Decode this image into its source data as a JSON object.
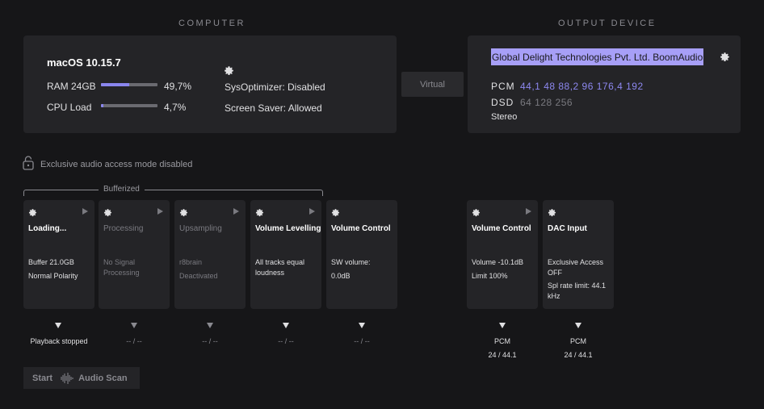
{
  "sections": {
    "computer": "COMPUTER",
    "output": "OUTPUT DEVICE"
  },
  "computer": {
    "os": "macOS 10.15.7",
    "ram_label": "RAM 24GB",
    "ram_value": "49,7%",
    "ram_fraction": 0.497,
    "cpu_label": "CPU Load",
    "cpu_value": "4,7%",
    "cpu_fraction": 0.047,
    "sysoptimizer": "SysOptimizer: Disabled",
    "screensaver": "Screen Saver: Allowed"
  },
  "virtual_button": "Virtual",
  "output": {
    "device": "Global Delight Technologies Pvt. Ltd. BoomAudio",
    "pcm_label": "PCM",
    "pcm_rates": "44,1 48 88,2 96 176,4 192",
    "dsd_label": "DSD",
    "dsd_rates": "64 128 256",
    "channels": "Stereo"
  },
  "exclusive": "Exclusive audio access mode disabled",
  "bufferized": "Bufferized",
  "stages": [
    {
      "title": "Loading...",
      "desc1": "Buffer 21.0GB",
      "desc2": "Normal Polarity",
      "under": "Playback stopped"
    },
    {
      "title": "Processing",
      "desc1": "No Signal Processing",
      "desc2": "",
      "under": "-- / --"
    },
    {
      "title": "Upsampling",
      "desc1": "r8brain",
      "desc2": "Deactivated",
      "under": "-- / --"
    },
    {
      "title": "Volume Levelling",
      "desc1": "All tracks equal loudness",
      "desc2": "",
      "under": "-- / --"
    },
    {
      "title": "Volume Control",
      "desc1": "SW volume:",
      "desc2": "0.0dB",
      "under": "-- / --"
    },
    {
      "title": "Volume Control",
      "desc1": "Volume -10.1dB",
      "desc2": "Limit 100%",
      "under1": "PCM",
      "under2": "24 / 44.1"
    },
    {
      "title": "DAC Input",
      "desc1": "Exclusive Access OFF",
      "desc2": "Spl rate limit: 44.1 kHz",
      "under1": "PCM",
      "under2": "24 / 44.1"
    }
  ],
  "start_button": {
    "start": "Start",
    "label": "Audio Scan"
  },
  "icons": {
    "gear": "gear-icon",
    "lock": "unlock-icon",
    "play": "play-icon",
    "wave": "waveform-icon"
  },
  "colors": {
    "accent": "#8a86ee",
    "selection": "#a79ff7",
    "card": "#242427",
    "background": "#161618"
  }
}
